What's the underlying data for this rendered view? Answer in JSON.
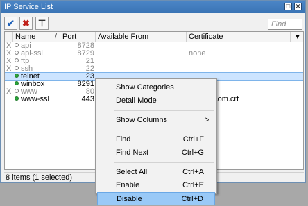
{
  "window": {
    "title": "IP Service List",
    "restore_glyph": "□",
    "close_glyph": "✕"
  },
  "toolbar": {
    "enable_icon": "✔",
    "disable_icon": "✖",
    "filter_icon": "⊤",
    "find_placeholder": "Find"
  },
  "columns": [
    "Name",
    "Port",
    "Available From",
    "Certificate"
  ],
  "sort_indicator": "/",
  "menu_glyph": "▼",
  "rows": [
    {
      "flag": "X",
      "name": "api",
      "port": "8728",
      "from": "",
      "cert": "",
      "disabled": true,
      "selected": false
    },
    {
      "flag": "X",
      "name": "api-ssl",
      "port": "8729",
      "from": "",
      "cert": "none",
      "disabled": true,
      "selected": false
    },
    {
      "flag": "X",
      "name": "ftp",
      "port": "21",
      "from": "",
      "cert": "",
      "disabled": true,
      "selected": false
    },
    {
      "flag": "X",
      "name": "ssh",
      "port": "22",
      "from": "",
      "cert": "",
      "disabled": true,
      "selected": false
    },
    {
      "flag": "",
      "name": "telnet",
      "port": "23",
      "from": "",
      "cert": "",
      "disabled": false,
      "selected": true
    },
    {
      "flag": "",
      "name": "winbox",
      "port": "8291",
      "from": "",
      "cert": "",
      "disabled": false,
      "selected": false
    },
    {
      "flag": "X",
      "name": "www",
      "port": "80",
      "from": "",
      "cert": "",
      "disabled": true,
      "selected": false
    },
    {
      "flag": "",
      "name": "www-ssl",
      "port": "443",
      "from": "",
      "cert": "hsheet.com.crt",
      "disabled": false,
      "selected": false
    }
  ],
  "status": "8 items (1 selected)",
  "context_menu": [
    {
      "label": "Show Categories",
      "shortcut": ""
    },
    {
      "label": "Detail Mode",
      "shortcut": ""
    },
    {
      "separator": true
    },
    {
      "label": "Show Columns",
      "shortcut": "",
      "submenu": true
    },
    {
      "separator": true
    },
    {
      "label": "Find",
      "shortcut": "Ctrl+F"
    },
    {
      "label": "Find Next",
      "shortcut": "Ctrl+G"
    },
    {
      "separator": true
    },
    {
      "label": "Select All",
      "shortcut": "Ctrl+A"
    },
    {
      "label": "Enable",
      "shortcut": "Ctrl+E"
    },
    {
      "label": "Disable",
      "shortcut": "Ctrl+D",
      "highlighted": true
    }
  ],
  "submenu_glyph": ">",
  "colors": {
    "titlebar": "#3a74b5",
    "selected_row": "#cce4ff",
    "menu_highlight": "#99c9f7",
    "enabled_dot": "#2aa63a"
  }
}
